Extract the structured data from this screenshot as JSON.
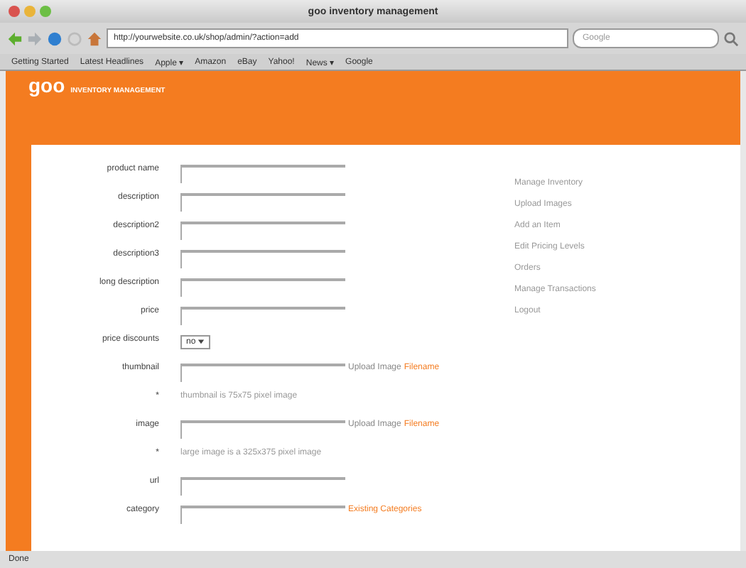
{
  "window": {
    "title": "goo inventory management"
  },
  "toolbar": {
    "url": "http://yourwebsite.co.uk/shop/admin/?action=add",
    "search_placeholder": "Google"
  },
  "bookmarks": [
    {
      "label": "Getting Started"
    },
    {
      "label": "Latest Headlines"
    },
    {
      "label": "Apple ▾"
    },
    {
      "label": "Amazon"
    },
    {
      "label": "eBay"
    },
    {
      "label": "Yahoo!"
    },
    {
      "label": "News ▾"
    },
    {
      "label": "Google"
    }
  ],
  "header": {
    "logo": "goo",
    "subtitle": "INVENTORY MANAGEMENT"
  },
  "form": [
    {
      "kind": "text",
      "label": "product name"
    },
    {
      "kind": "text",
      "label": "description"
    },
    {
      "kind": "text",
      "label": "description2"
    },
    {
      "kind": "text",
      "label": "description3"
    },
    {
      "kind": "text",
      "label": "long description"
    },
    {
      "kind": "text",
      "label": "price"
    },
    {
      "kind": "select",
      "label": "price discounts",
      "value": "no"
    },
    {
      "kind": "text",
      "label": "thumbnail",
      "aside": "Upload Image",
      "link": "Filename"
    },
    {
      "kind": "note",
      "marker": "*",
      "text": "thumbnail is 75x75 pixel image"
    },
    {
      "kind": "text",
      "label": "image",
      "aside": "Upload Image",
      "link": "Filename"
    },
    {
      "kind": "note",
      "marker": "*",
      "text": "large image is a 325x375 pixel image"
    },
    {
      "kind": "text",
      "label": "url"
    },
    {
      "kind": "text",
      "label": "category",
      "link": "Existing Categories"
    }
  ],
  "sidebar": {
    "items": [
      {
        "label": "Manage Inventory"
      },
      {
        "label": "Upload Images"
      },
      {
        "label": "Add an Item"
      },
      {
        "label": "Edit Pricing Levels"
      },
      {
        "label": "Orders"
      },
      {
        "label": "Manage Transactions"
      },
      {
        "label": "Logout"
      }
    ]
  },
  "status_bar": "Done"
}
